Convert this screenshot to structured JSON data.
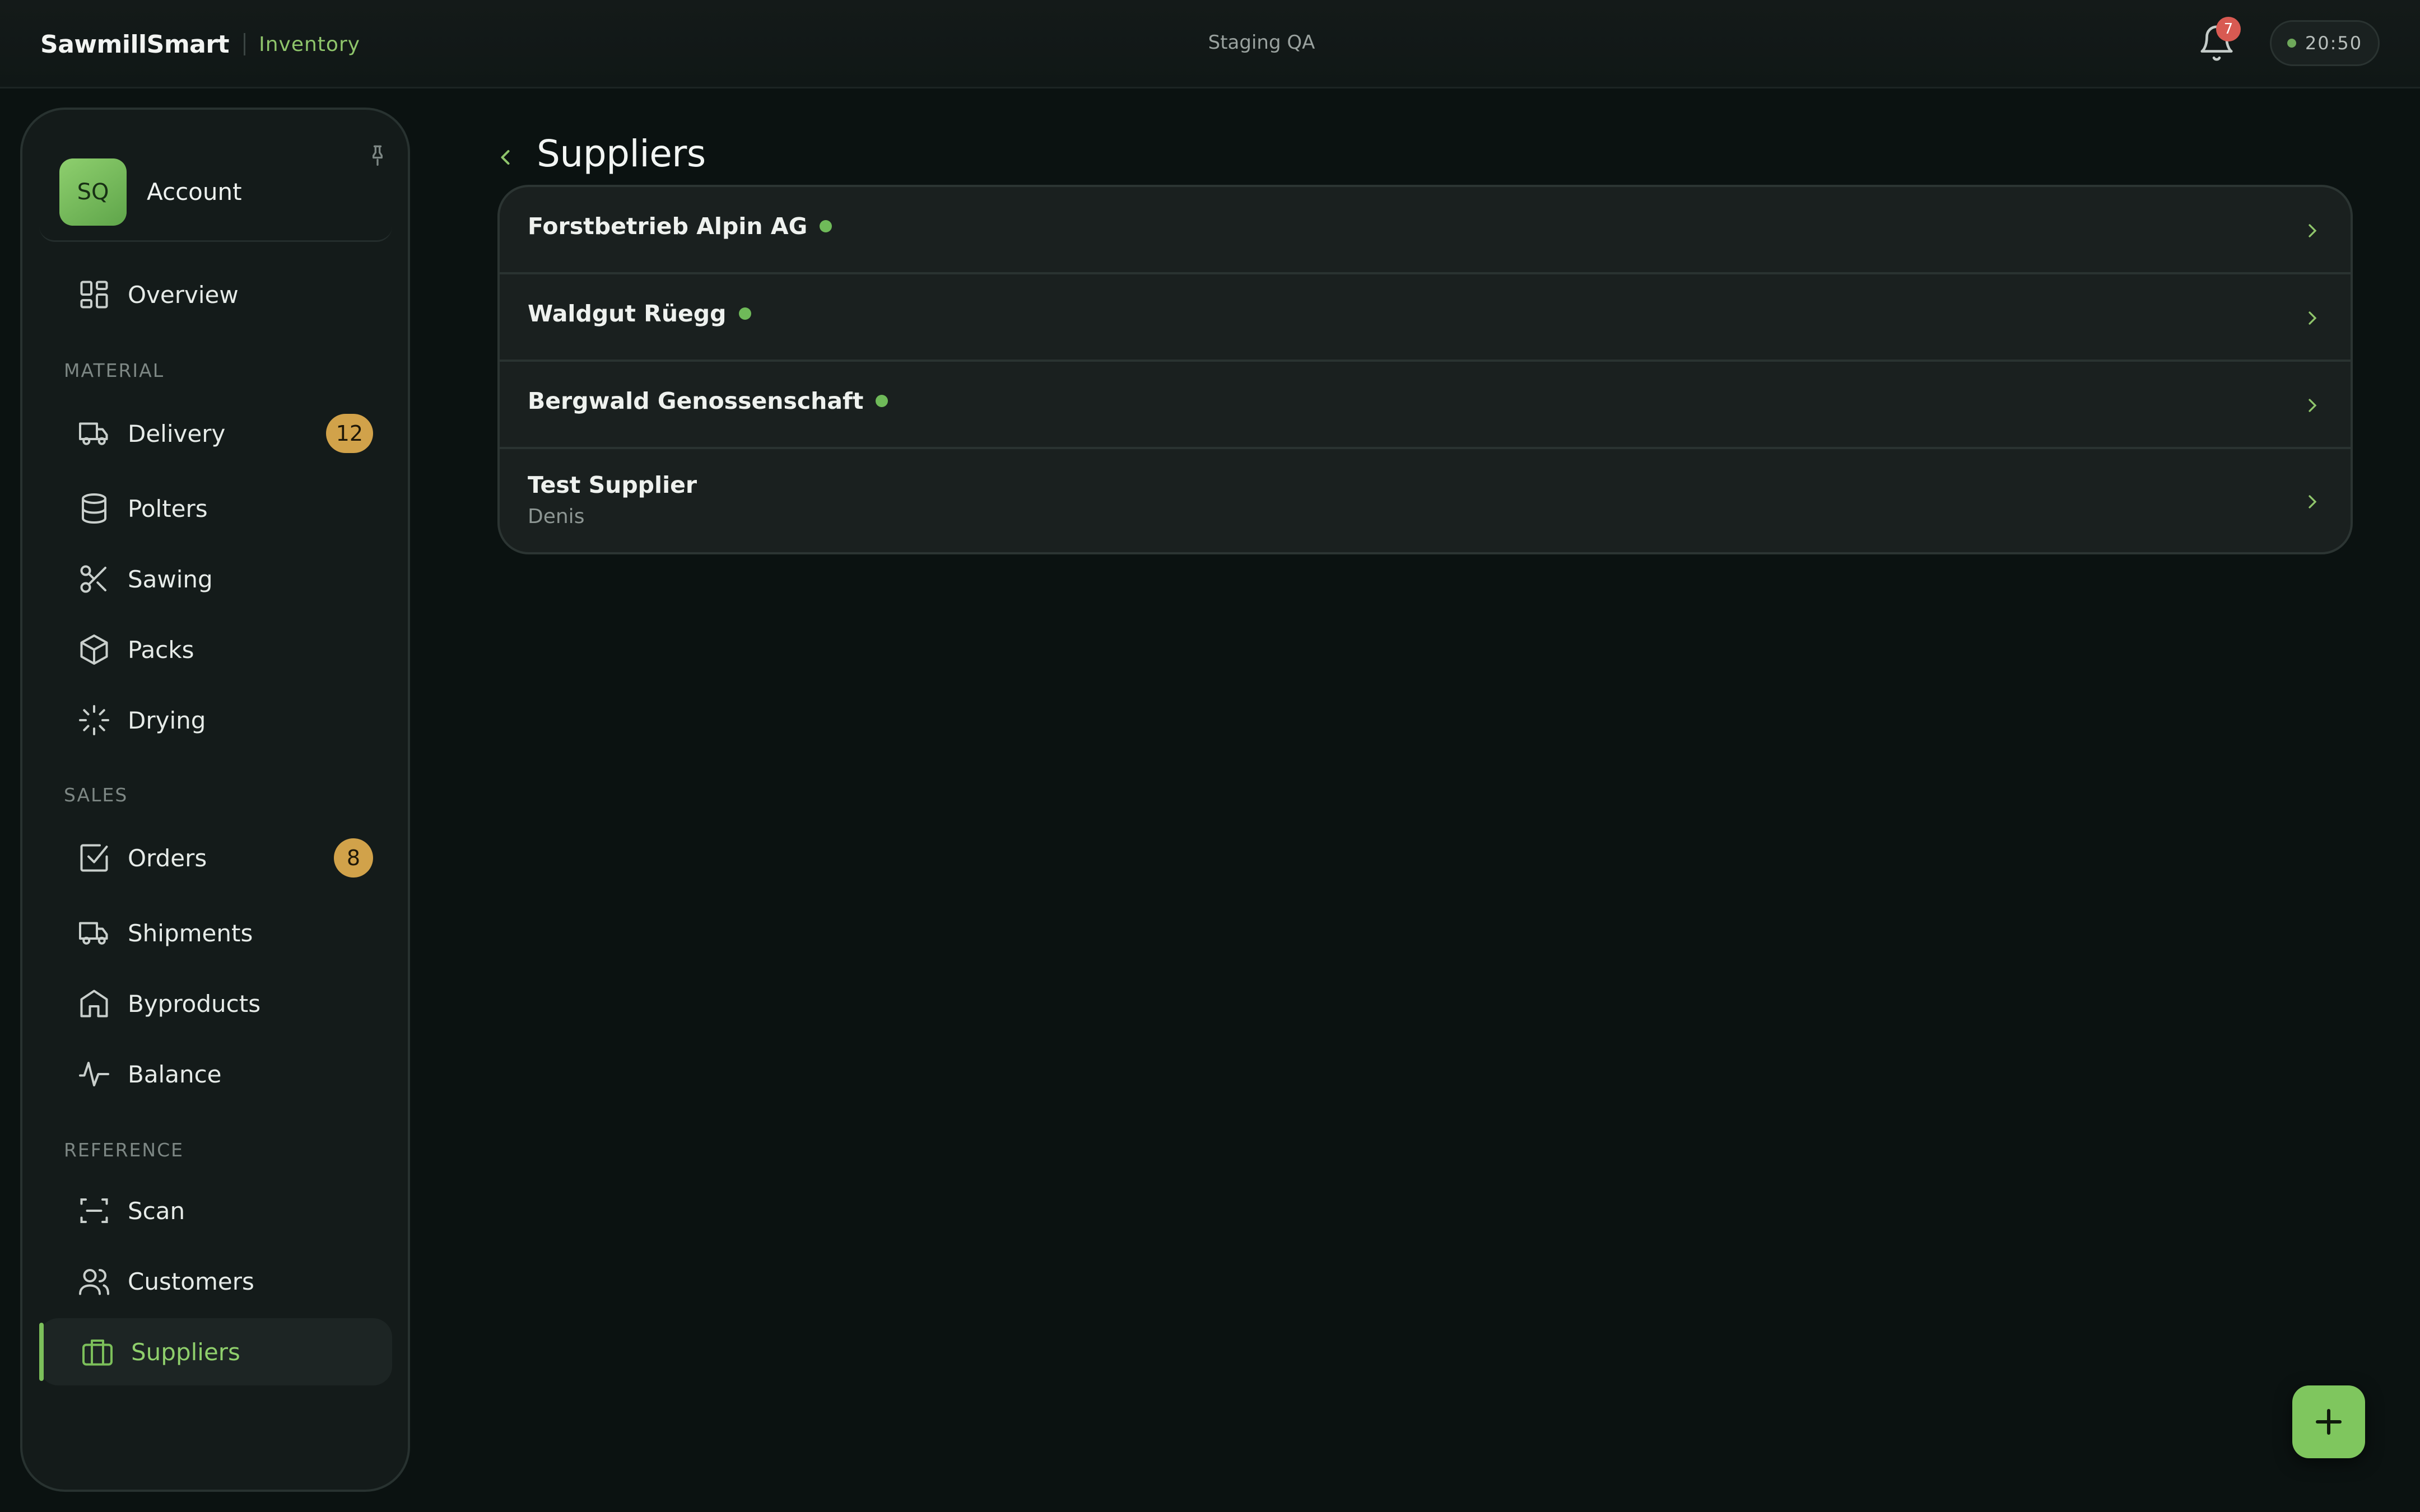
{
  "header": {
    "brand": "SawmillSmart",
    "section": "Inventory",
    "environment": "Staging QA",
    "notification_count": "7",
    "time": "20:50"
  },
  "sidebar": {
    "account": {
      "initials": "SQ",
      "label": "Account"
    },
    "overview": "Overview",
    "sections": {
      "material": "MATERIAL",
      "sales": "SALES",
      "reference": "REFERENCE"
    },
    "items": {
      "delivery": {
        "label": "Delivery",
        "badge": "12"
      },
      "polters": {
        "label": "Polters"
      },
      "sawing": {
        "label": "Sawing"
      },
      "packs": {
        "label": "Packs"
      },
      "drying": {
        "label": "Drying"
      },
      "orders": {
        "label": "Orders",
        "badge": "8"
      },
      "shipments": {
        "label": "Shipments"
      },
      "byproducts": {
        "label": "Byproducts"
      },
      "balance": {
        "label": "Balance"
      },
      "scan": {
        "label": "Scan"
      },
      "customers": {
        "label": "Customers"
      },
      "suppliers": {
        "label": "Suppliers"
      }
    }
  },
  "main": {
    "title": "Suppliers",
    "suppliers": [
      {
        "name": "Forstbetrieb Alpin AG",
        "status": "active"
      },
      {
        "name": "Waldgut Rüegg",
        "status": "active"
      },
      {
        "name": "Bergwald Genossenschaft",
        "status": "active"
      },
      {
        "name": "Test Supplier",
        "subtitle": "Denis"
      }
    ]
  },
  "colors": {
    "accent": "#7fc65e",
    "badge": "#d1a24a",
    "notification": "#d85a52",
    "background": "#0b1211"
  }
}
